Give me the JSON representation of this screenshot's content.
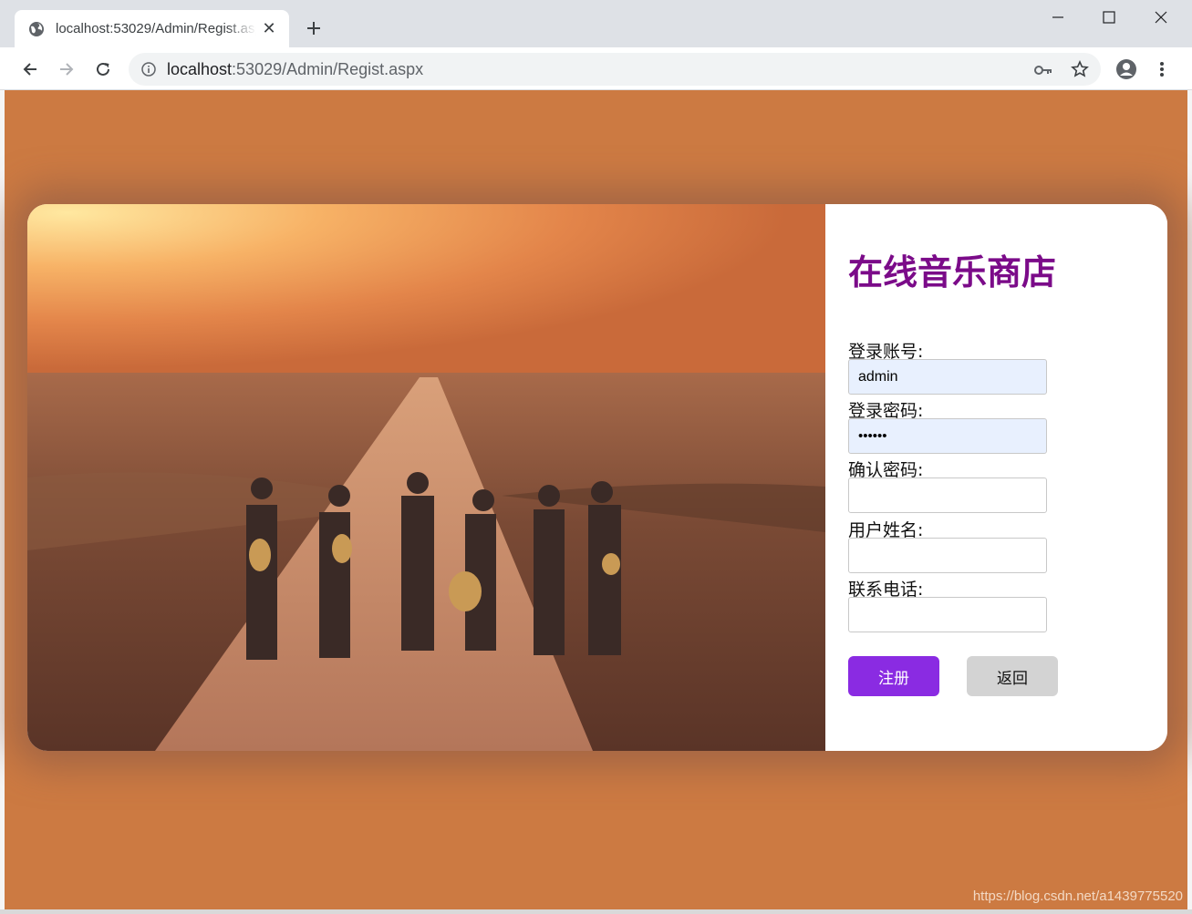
{
  "browser": {
    "tab_title": "localhost:53029/Admin/Regist.aspx",
    "url_host": "localhost",
    "url_rest": ":53029/Admin/Regist.aspx",
    "new_tab_glyph": "+",
    "close_glyph": "✕"
  },
  "page": {
    "background_color": "#cc7a42",
    "hero_image": "photo of six people walking down a dirt country road at sunset, some carrying guitars",
    "form": {
      "title": "在线音乐商店",
      "title_color": "#7b0b89",
      "fields": [
        {
          "label": "登录账号:",
          "value": "admin"
        },
        {
          "label": "登录密码:",
          "value": "••••••"
        },
        {
          "label": "确认密码:",
          "value": ""
        },
        {
          "label": "用户姓名:",
          "value": ""
        },
        {
          "label": "联系电话:",
          "value": ""
        }
      ],
      "register_label": "注册",
      "register_color": "#8a2be2",
      "back_label": "返回"
    }
  },
  "watermark": "https://blog.csdn.net/a1439775520",
  "icons": [
    "globe-icon",
    "close-icon",
    "plus-icon",
    "minimize-icon",
    "maximize-icon",
    "window-close-icon",
    "back-arrow-icon",
    "forward-arrow-icon",
    "reload-icon",
    "info-icon",
    "key-icon",
    "star-icon",
    "account-icon",
    "menu-dots-icon"
  ]
}
